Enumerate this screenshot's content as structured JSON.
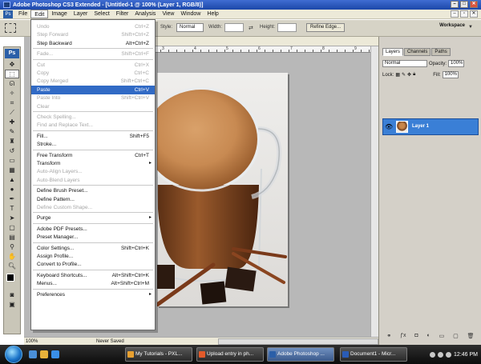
{
  "window": {
    "title": "Adobe Photoshop CS3 Extended - [Untitled-1 @ 100% (Layer 1, RGB/8)]"
  },
  "menubar": {
    "items": [
      "File",
      "Edit",
      "Image",
      "Layer",
      "Select",
      "Filter",
      "Analysis",
      "View",
      "Window",
      "Help"
    ],
    "active": "Edit"
  },
  "options": {
    "style_label": "Style:",
    "style_value": "Normal",
    "width_label": "Width:",
    "height_label": "Height:",
    "refine_edge": "Refine Edge...",
    "workspace": "Workspace"
  },
  "ruler": {
    "marks": [
      "3",
      "4",
      "5",
      "6",
      "7",
      "8",
      "9"
    ]
  },
  "edit_menu": [
    {
      "label": "Undo",
      "shortcut": "Ctrl+Z",
      "disabled": true
    },
    {
      "label": "Step Forward",
      "shortcut": "Shift+Ctrl+Z",
      "disabled": true
    },
    {
      "label": "Step Backward",
      "shortcut": "Alt+Ctrl+Z",
      "disabled": false
    },
    {
      "sep": true
    },
    {
      "label": "Fade...",
      "shortcut": "Shift+Ctrl+F",
      "disabled": true
    },
    {
      "sep": true
    },
    {
      "label": "Cut",
      "shortcut": "Ctrl+X",
      "disabled": true
    },
    {
      "label": "Copy",
      "shortcut": "Ctrl+C",
      "disabled": true
    },
    {
      "label": "Copy Merged",
      "shortcut": "Shift+Ctrl+C",
      "disabled": true
    },
    {
      "label": "Paste",
      "shortcut": "Ctrl+V",
      "disabled": false,
      "highlighted": true
    },
    {
      "label": "Paste Into",
      "shortcut": "Shift+Ctrl+V",
      "disabled": true
    },
    {
      "label": "Clear",
      "shortcut": "",
      "disabled": true
    },
    {
      "sep": true
    },
    {
      "label": "Check Spelling...",
      "shortcut": "",
      "disabled": true
    },
    {
      "label": "Find and Replace Text...",
      "shortcut": "",
      "disabled": true
    },
    {
      "sep": true
    },
    {
      "label": "Fill...",
      "shortcut": "Shift+F5",
      "disabled": false
    },
    {
      "label": "Stroke...",
      "shortcut": "",
      "disabled": false
    },
    {
      "sep": true
    },
    {
      "label": "Free Transform",
      "shortcut": "Ctrl+T",
      "disabled": false
    },
    {
      "label": "Transform",
      "shortcut": "",
      "disabled": false,
      "submenu": true
    },
    {
      "label": "Auto-Align Layers...",
      "shortcut": "",
      "disabled": true
    },
    {
      "label": "Auto-Blend Layers",
      "shortcut": "",
      "disabled": true
    },
    {
      "sep": true
    },
    {
      "label": "Define Brush Preset...",
      "shortcut": "",
      "disabled": false
    },
    {
      "label": "Define Pattern...",
      "shortcut": "",
      "disabled": false
    },
    {
      "label": "Define Custom Shape...",
      "shortcut": "",
      "disabled": true
    },
    {
      "sep": true
    },
    {
      "label": "Purge",
      "shortcut": "",
      "disabled": false,
      "submenu": true
    },
    {
      "sep": true
    },
    {
      "label": "Adobe PDF Presets...",
      "shortcut": "",
      "disabled": false
    },
    {
      "label": "Preset Manager...",
      "shortcut": "",
      "disabled": false
    },
    {
      "sep": true
    },
    {
      "label": "Color Settings...",
      "shortcut": "Shift+Ctrl+K",
      "disabled": false
    },
    {
      "label": "Assign Profile...",
      "shortcut": "",
      "disabled": false
    },
    {
      "label": "Convert to Profile...",
      "shortcut": "",
      "disabled": false
    },
    {
      "sep": true
    },
    {
      "label": "Keyboard Shortcuts...",
      "shortcut": "Alt+Shift+Ctrl+K",
      "disabled": false
    },
    {
      "label": "Menus...",
      "shortcut": "Alt+Shift+Ctrl+M",
      "disabled": false
    },
    {
      "sep": true
    },
    {
      "label": "Preferences",
      "shortcut": "",
      "disabled": false,
      "submenu": true
    }
  ],
  "toolbox": {
    "logo": "Ps"
  },
  "layers_panel": {
    "tabs": [
      "Layers",
      "Channels",
      "Paths"
    ],
    "active_tab": "Layers",
    "blend_mode": "Normal",
    "opacity_label": "Opacity:",
    "opacity": "100%",
    "lock_label": "Lock:",
    "fill_label": "Fill:",
    "fill": "100%",
    "layer_name": "Layer 1"
  },
  "status": {
    "zoom": "100%",
    "info": "Never Saved"
  },
  "taskbar": {
    "tasks": [
      {
        "label": "My Tutorials - PXL...",
        "color": "#e8a030"
      },
      {
        "label": "Upload entry in ph...",
        "color": "#e25a2a"
      },
      {
        "label": "Adobe Photoshop ...",
        "color": "#2b5fa8",
        "active": true
      },
      {
        "label": "Document1 - Micr...",
        "color": "#2a5bb5"
      }
    ],
    "clock": "12:46 PM"
  },
  "colors": {
    "highlight": "#316ac5",
    "layer_selected": "#3a7fd6",
    "menu_disabled": "#a6a6a6"
  }
}
